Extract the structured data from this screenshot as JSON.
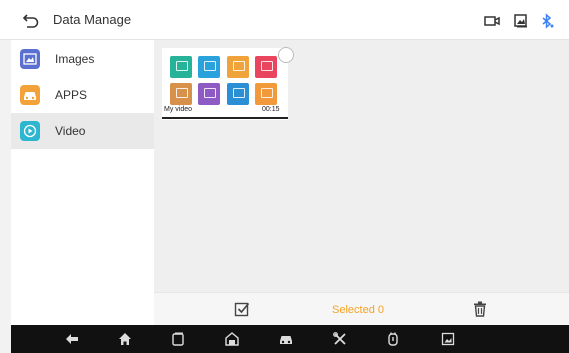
{
  "header": {
    "title": "Data Manage",
    "icons": [
      "back-arrow-icon",
      "video-camera-icon",
      "image-icon",
      "bluetooth-icon"
    ],
    "bluetooth_color": "#3b82f6"
  },
  "sidebar": {
    "items": [
      {
        "label": "Images",
        "icon": "images-icon",
        "color": "#5b6fd1",
        "active": false
      },
      {
        "label": "APPS",
        "icon": "car-icon",
        "color": "#f3a23a",
        "active": false
      },
      {
        "label": "Video",
        "icon": "play-icon",
        "color": "#2db6cf",
        "active": true
      }
    ]
  },
  "content": {
    "thumbnail": {
      "caption_left": "My video",
      "caption_right": "00:15",
      "tile_colors": [
        "#26b39a",
        "#2aa3dd",
        "#f0a33a",
        "#e9455f",
        "#d8914a",
        "#8e5bc4",
        "#2b8fd6",
        "#f29a3b"
      ]
    }
  },
  "actionbar": {
    "selected_label": "Selected 0",
    "accent": "#f5a323"
  },
  "navbar": {
    "icons": [
      "nav-back-icon",
      "nav-home-icon",
      "nav-recent-icon",
      "nav-garage-icon",
      "nav-car-icon",
      "nav-tools-icon",
      "nav-vci-icon",
      "nav-screenshot-icon"
    ]
  }
}
